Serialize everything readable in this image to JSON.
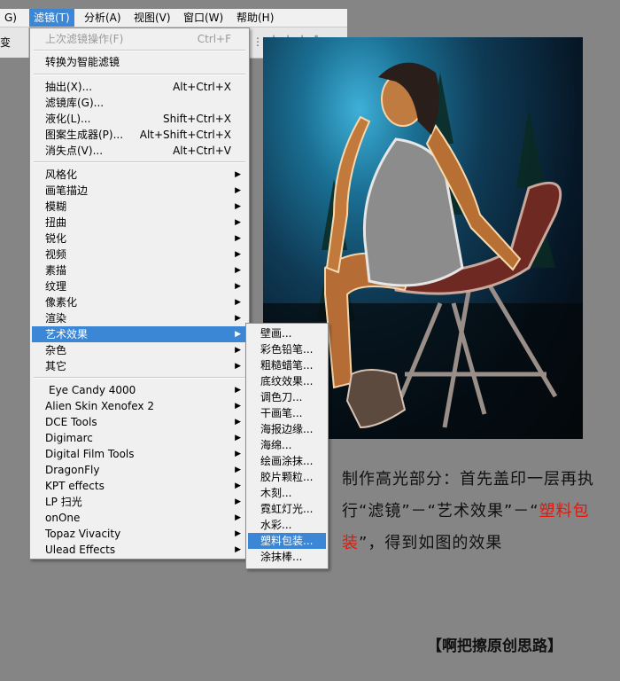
{
  "menubar": {
    "items": [
      {
        "label": "G)",
        "active": false
      },
      {
        "label": "滤镜(T)",
        "active": true
      },
      {
        "label": "分析(A)",
        "active": false
      },
      {
        "label": "视图(V)",
        "active": false
      },
      {
        "label": "窗口(W)",
        "active": false
      },
      {
        "label": "帮助(H)",
        "active": false
      }
    ],
    "toolbar_fragment": "变"
  },
  "filter_menu": {
    "last_filter": {
      "label": "上次滤镜操作(F)",
      "shortcut": "Ctrl+F"
    },
    "smart_filter": "转换为智能滤镜",
    "tools": [
      {
        "label": "抽出(X)...",
        "shortcut": "Alt+Ctrl+X"
      },
      {
        "label": "滤镜库(G)...",
        "shortcut": ""
      },
      {
        "label": "液化(L)...",
        "shortcut": "Shift+Ctrl+X"
      },
      {
        "label": "图案生成器(P)...",
        "shortcut": "Alt+Shift+Ctrl+X"
      },
      {
        "label": "消失点(V)...",
        "shortcut": "Alt+Ctrl+V"
      }
    ],
    "categories": [
      "风格化",
      "画笔描边",
      "模糊",
      "扭曲",
      "锐化",
      "视频",
      "素描",
      "纹理",
      "像素化",
      "渲染",
      "艺术效果",
      "杂色",
      "其它"
    ],
    "highlighted_category": "艺术效果",
    "plugins": [
      "Eye Candy 4000",
      "Alien Skin Xenofex 2",
      "DCE Tools",
      "Digimarc",
      "Digital Film Tools",
      "DragonFly",
      "KPT effects",
      "LP 扫光",
      "onOne",
      "Topaz Vivacity",
      "Ulead Effects"
    ]
  },
  "artistic_submenu": {
    "items": [
      "壁画...",
      "彩色铅笔...",
      "粗糙蜡笔...",
      "底纹效果...",
      "调色刀...",
      "干画笔...",
      "海报边缘...",
      "海绵...",
      "绘画涂抹...",
      "胶片颗粒...",
      "木刻...",
      "霓虹灯光...",
      "水彩...",
      "塑料包装...",
      "涂抹棒..."
    ],
    "highlighted": "塑料包装..."
  },
  "caption": {
    "part1": "制作高光部分：首先盖印一层再执行“滤镜”－“艺术效果”－“",
    "highlight": "塑料包装",
    "part2": "”，得到如图的效果"
  },
  "signature": "【啊把擦原创思路】",
  "colors": {
    "menu_highlight": "#3b87d6",
    "caption_highlight": "#e3170b"
  }
}
